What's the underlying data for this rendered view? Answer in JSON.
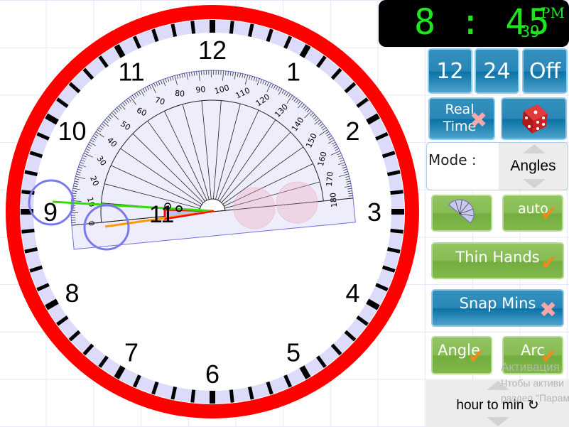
{
  "clock": {
    "hour_numbers": [
      "12",
      "1",
      "2",
      "3",
      "4",
      "5",
      "6",
      "7",
      "8",
      "9",
      "10",
      "11"
    ],
    "angle_label": "11°",
    "colors": {
      "ring": "#ff0000",
      "tick_band": "#dcdcfa",
      "minute_hand": "#33dd00",
      "hour_hand": "#ff9900",
      "angle_marker": "#ff0000"
    }
  },
  "protractor": {
    "labels": [
      "0",
      "10",
      "20",
      "30",
      "40",
      "50",
      "60",
      "70",
      "80",
      "90",
      "100",
      "110",
      "120",
      "130",
      "140",
      "150",
      "160",
      "170",
      "180"
    ]
  },
  "digital": {
    "hours_minutes": "8 : 45",
    "seconds": "39",
    "ampm": "PM"
  },
  "buttons": {
    "format_12": "12",
    "format_24": "24",
    "format_off": "Off",
    "real_time": "Real Time",
    "random_icon": "dice-icon",
    "auto": "auto",
    "thin_hands": "Thin Hands",
    "snap_mins": "Snap Mins",
    "angle": "Angle",
    "arc": "Arc"
  },
  "mode": {
    "label": "Mode :",
    "value": "Angles"
  },
  "direction": {
    "value": "hour to min ↻"
  },
  "watermark": {
    "line1": "Активация",
    "line2": "Чтобы активи",
    "line3": "раздел \"Парам"
  }
}
